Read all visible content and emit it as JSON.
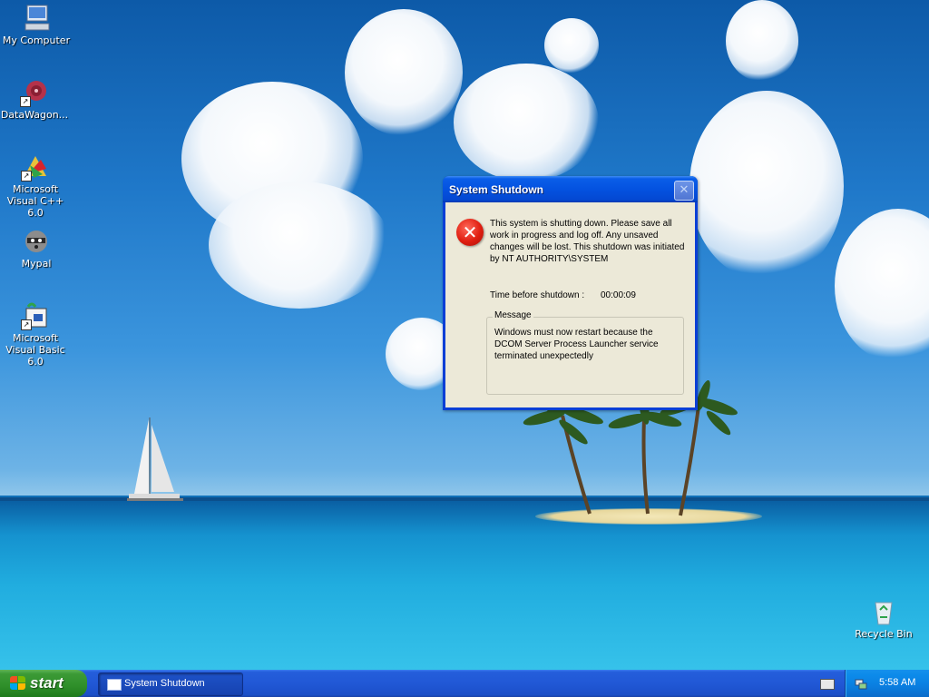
{
  "desktop": {
    "icons": [
      {
        "label": "My Computer",
        "icon": "my-computer-icon"
      },
      {
        "label": "DataWagon...",
        "icon": "datawagon-icon"
      },
      {
        "label": "Microsoft Visual C++ 6.0",
        "icon": "visual-cpp-icon"
      },
      {
        "label": "Mypal",
        "icon": "mypal-raccoon-icon"
      },
      {
        "label": "Microsoft Visual Basic 6.0",
        "icon": "visual-basic-icon"
      },
      {
        "label": "Recycle Bin",
        "icon": "recycle-bin-icon"
      }
    ]
  },
  "dialog": {
    "title": "System Shutdown",
    "close_glyph": "✕",
    "icon": "error-icon",
    "message": "This system is shutting down. Please save all work in progress and log off. Any unsaved changes will be lost. This shutdown was initiated by NT AUTHORITY\\SYSTEM",
    "timer_label": "Time before shutdown :",
    "timer_value": "00:00:09",
    "group_label": "Message",
    "group_message": "Windows must now restart because the DCOM Server Process Launcher service terminated unexpectedly"
  },
  "taskbar": {
    "start_label": "start",
    "task_button_label": "System Shutdown",
    "clock": "5:58 AM"
  },
  "colors": {
    "titlebar": "#0452e0",
    "dialog_face": "#ece9d8",
    "taskbar": "#245edb",
    "start_button": "#3c9a36",
    "tray": "#0c8bea"
  }
}
